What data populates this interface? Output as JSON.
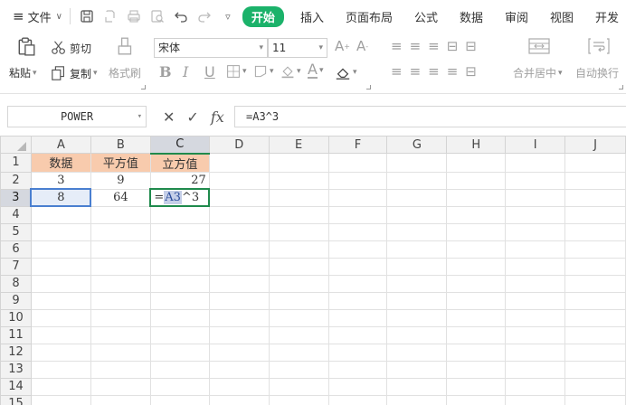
{
  "menubar": {
    "file_label": "文件",
    "tabs": [
      "开始",
      "插入",
      "页面布局",
      "公式",
      "数据",
      "审阅",
      "视图",
      "开发"
    ]
  },
  "ribbon": {
    "paste_label": "粘贴",
    "cut_label": "剪切",
    "copy_label": "复制",
    "format_painter_label": "格式刷",
    "font_name": "宋体",
    "font_size": "11",
    "merge_center_label": "合并居中",
    "wrap_text_label": "自动换行"
  },
  "formula_bar": {
    "name_box": "POWER",
    "fx_label": "fx",
    "formula": "=A3^3"
  },
  "sheet": {
    "columns": [
      "A",
      "B",
      "C",
      "D",
      "E",
      "F",
      "G",
      "H",
      "I",
      "J"
    ],
    "rows": [
      "1",
      "2",
      "3",
      "4",
      "5",
      "6",
      "7",
      "8",
      "9",
      "10",
      "11",
      "12",
      "13",
      "14",
      "15"
    ],
    "cells": {
      "A1": "数据",
      "B1": "平方值",
      "C1": "立方值",
      "A2": "3",
      "B2": "9",
      "C2": "27",
      "A3": "8",
      "B3": "64",
      "C3_prefix": "=",
      "C3_ref": "A3",
      "C3_suffix": "^3"
    }
  },
  "colors": {
    "accent_green": "#1bb26a",
    "header_fill": "#f8cbad",
    "selection_blue": "#4a7fd0",
    "active_border": "#1f8a4c"
  }
}
